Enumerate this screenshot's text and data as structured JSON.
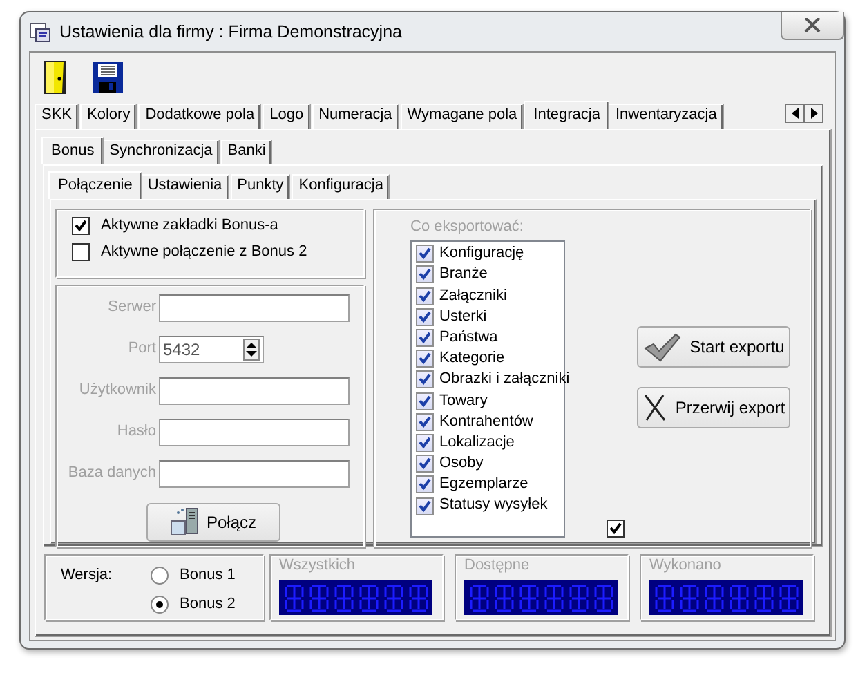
{
  "window": {
    "title": "Ustawienia dla firmy  : Firma Demonstracyjna"
  },
  "tabs": [
    {
      "label": "SKK",
      "selected": false
    },
    {
      "label": "Kolory",
      "selected": false
    },
    {
      "label": "Dodatkowe pola",
      "selected": false
    },
    {
      "label": "Logo",
      "selected": false
    },
    {
      "label": "Numeracja",
      "selected": false
    },
    {
      "label": "Wymagane pola",
      "selected": false
    },
    {
      "label": "Integracja",
      "selected": true
    },
    {
      "label": "Inwentaryzacja",
      "selected": false
    }
  ],
  "subtabs": [
    {
      "label": "Bonus",
      "selected": true
    },
    {
      "label": "Synchronizacja",
      "selected": false
    },
    {
      "label": "Banki",
      "selected": false
    }
  ],
  "bonus_tabs": [
    {
      "label": "Połączenie",
      "selected": true
    },
    {
      "label": "Ustawienia",
      "selected": false
    },
    {
      "label": "Punkty",
      "selected": false
    },
    {
      "label": "Konfiguracja",
      "selected": false
    }
  ],
  "options": [
    {
      "label": "Aktywne zakładki Bonus-a",
      "checked": true
    },
    {
      "label": "Aktywne połączenie z Bonus 2",
      "checked": false
    }
  ],
  "connection": {
    "disabled": true,
    "fields": [
      {
        "label": "Serwer",
        "kind": "text"
      },
      {
        "label": "Port",
        "kind": "spin",
        "value": "5432"
      },
      {
        "label": "Użytkownik",
        "kind": "text"
      },
      {
        "label": "Hasło",
        "kind": "text"
      },
      {
        "label": "Baza danych",
        "kind": "text"
      }
    ],
    "button": "Połącz"
  },
  "export": {
    "title": "Co eksportować:",
    "title_disabled": true,
    "items": [
      {
        "label": "Konfigurację",
        "checked": true
      },
      {
        "label": "Branże",
        "checked": true
      },
      {
        "label": "Załączniki",
        "checked": true
      },
      {
        "label": "Usterki",
        "checked": true
      },
      {
        "label": "Państwa",
        "checked": true
      },
      {
        "label": "Kategorie",
        "checked": true
      },
      {
        "label": "Obrazki i załączniki",
        "checked": true
      },
      {
        "label": "Towary",
        "checked": true
      },
      {
        "label": "Kontrahentów",
        "checked": true
      },
      {
        "label": "Lokalizacje",
        "checked": true
      },
      {
        "label": "Osoby",
        "checked": true
      },
      {
        "label": "Egzemplarze",
        "checked": true
      },
      {
        "label": "Statusy wysyłek",
        "checked": true
      }
    ],
    "select_all": {
      "checked": true
    },
    "buttons": [
      {
        "label": "Start exportu",
        "kind": "start"
      },
      {
        "label": "Przerwij export",
        "kind": "stop"
      }
    ]
  },
  "version": {
    "label": "Wersja:",
    "options": [
      {
        "label": "Bonus 1",
        "selected": false
      },
      {
        "label": "Bonus 2",
        "selected": true
      }
    ]
  },
  "counters": [
    {
      "label": "Wszystkich",
      "disabled": true
    },
    {
      "label": "Dostępne",
      "disabled": true
    },
    {
      "label": "Wykonano",
      "disabled": true
    }
  ]
}
